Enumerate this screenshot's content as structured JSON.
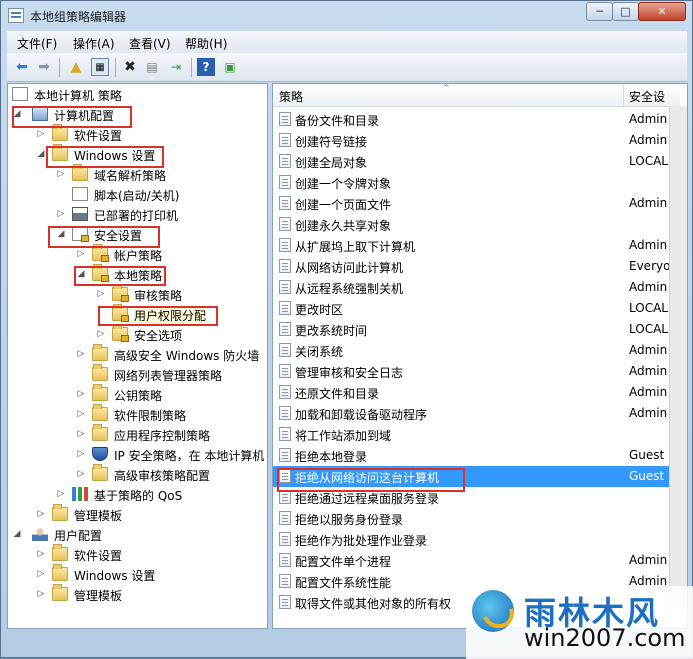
{
  "window": {
    "title": "本地组策略编辑器"
  },
  "controls": {
    "minimize": "─",
    "maximize": "□",
    "close": "✕"
  },
  "menu": [
    "文件(F)",
    "操作(A)",
    "查看(V)",
    "帮助(H)"
  ],
  "toolbar": {
    "icons": [
      "back-icon",
      "forward-icon",
      "up-folder-icon",
      "show-hide-tree-icon",
      "delete-icon",
      "properties-icon",
      "export-list-icon",
      "help-icon",
      "view-icon"
    ]
  },
  "tree": {
    "root": "本地计算机 策略",
    "nodes": [
      "计算机配置",
      "软件设置",
      "Windows 设置",
      "域名解析策略",
      "脚本(启动/关机)",
      "已部署的打印机",
      "安全设置",
      "帐户策略",
      "本地策略",
      "审核策略",
      "用户权限分配",
      "安全选项",
      "高级安全 Windows 防火墙",
      "网络列表管理器策略",
      "公钥策略",
      "软件限制策略",
      "应用程序控制策略",
      "IP 安全策略，在 本地计算机",
      "高级审核策略配置",
      "基于策略的 QoS",
      "管理模板",
      "用户配置",
      "软件设置",
      "Windows 设置",
      "管理模板"
    ]
  },
  "list": {
    "columns": [
      "策略",
      "安全设"
    ],
    "rows": [
      {
        "name": "备份文件和目录",
        "value": "Admin"
      },
      {
        "name": "创建符号链接",
        "value": "Admin"
      },
      {
        "name": "创建全局对象",
        "value": "LOCAL"
      },
      {
        "name": "创建一个令牌对象",
        "value": ""
      },
      {
        "name": "创建一个页面文件",
        "value": "Admin"
      },
      {
        "name": "创建永久共享对象",
        "value": ""
      },
      {
        "name": "从扩展坞上取下计算机",
        "value": "Admin"
      },
      {
        "name": "从网络访问此计算机",
        "value": "Everyo"
      },
      {
        "name": "从远程系统强制关机",
        "value": "Admin"
      },
      {
        "name": "更改时区",
        "value": "LOCAL"
      },
      {
        "name": "更改系统时间",
        "value": "LOCAL"
      },
      {
        "name": "关闭系统",
        "value": "Admin"
      },
      {
        "name": "管理审核和安全日志",
        "value": "Admin"
      },
      {
        "name": "还原文件和目录",
        "value": "Admin"
      },
      {
        "name": "加载和卸载设备驱动程序",
        "value": "Admin"
      },
      {
        "name": "将工作站添加到域",
        "value": ""
      },
      {
        "name": "拒绝本地登录",
        "value": "Guest"
      },
      {
        "name": "拒绝从网络访问这台计算机",
        "value": "Guest"
      },
      {
        "name": "拒绝通过远程桌面服务登录",
        "value": ""
      },
      {
        "name": "拒绝以服务身份登录",
        "value": ""
      },
      {
        "name": "拒绝作为批处理作业登录",
        "value": ""
      },
      {
        "name": "配置文件单个进程",
        "value": "Admin"
      },
      {
        "name": "配置文件系统性能",
        "value": "Admin"
      },
      {
        "name": "取得文件或其他对象的所有权",
        "value": ""
      }
    ]
  },
  "watermark": {
    "brand": "雨林木风",
    "url": "win2007.com"
  },
  "colors": {
    "selection": "#3399ff",
    "highlight_box": "#d8302b"
  }
}
